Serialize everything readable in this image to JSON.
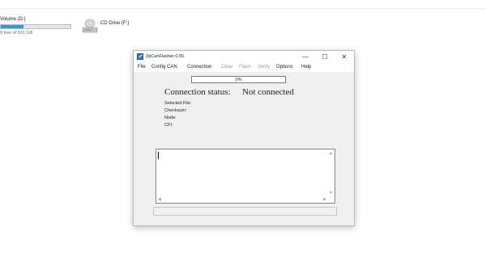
{
  "drives": [
    {
      "name": "Volume (D:)",
      "free_text": "8 free of 931 GB",
      "used_fraction": 0.32
    },
    {
      "name": "CD Drive (F:)"
    }
  ],
  "window": {
    "title": "ZpCanFlasher 0.55",
    "controls": {
      "minimize": "—",
      "maximize": "☐",
      "close": "✕"
    },
    "menu": [
      "File",
      "Config CAN",
      "Connection",
      "Clear",
      "Flash",
      "Verify",
      "Options",
      "Help"
    ],
    "progress_text": "0%",
    "progress_value": 0,
    "connection_status_label": "Connection status:",
    "connection_status_value": "Not connected",
    "info_labels": [
      "Selected File:",
      "Checksum:",
      "Node:",
      "CFI:"
    ]
  },
  "icons": {
    "cd_drive": "cd-drive-icon",
    "app": "app-icon"
  }
}
